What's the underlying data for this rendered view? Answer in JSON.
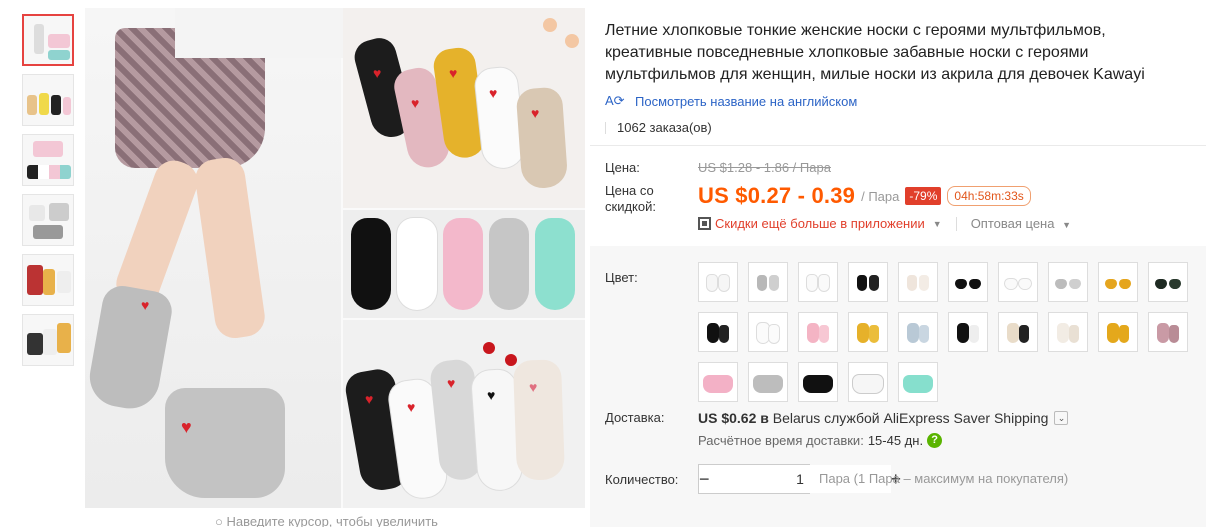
{
  "gallery": {
    "zoom_hint": "Наведите курсор, чтобы увеличить"
  },
  "product": {
    "title": "Летние хлопковые тонкие женские носки с героями мультфильмов, креативные повседневные хлопковые забавные носки с героями мультфильмов для женщин, милые носки из акрила для девочек Kawayi",
    "translate_link": "Посмотреть название на английском",
    "orders": "1062 заказа(ов)"
  },
  "price": {
    "price_label": "Цена:",
    "old_price": "US $1.28 - 1.86 / Пара",
    "discount_label": "Цена со скидкой:",
    "discount_price": "US $0.27 - 0.39",
    "unit": "/ Пара",
    "discount_badge": "-79%",
    "timer": "04h:58m:33s",
    "app_discount": "Скидки ещё больше в приложении",
    "wholesale": "Оптовая цена"
  },
  "options": {
    "color_label": "Цвет:"
  },
  "shipping": {
    "label": "Доставка:",
    "price": "US $0.62",
    "connector": "в",
    "destination": "Belarus службой AliExpress Saver Shipping",
    "delivery_time_label": "Расчётное время доставки:",
    "delivery_days": "15-45 дн."
  },
  "quantity": {
    "label": "Количество:",
    "value": "1",
    "note": "Пара (1 Пара – максимум на покупателя)",
    "minus": "−",
    "plus": "+"
  },
  "colors": {
    "accent": "#ff5a00",
    "badge": "#e13f2b",
    "link": "#2c64c6"
  }
}
